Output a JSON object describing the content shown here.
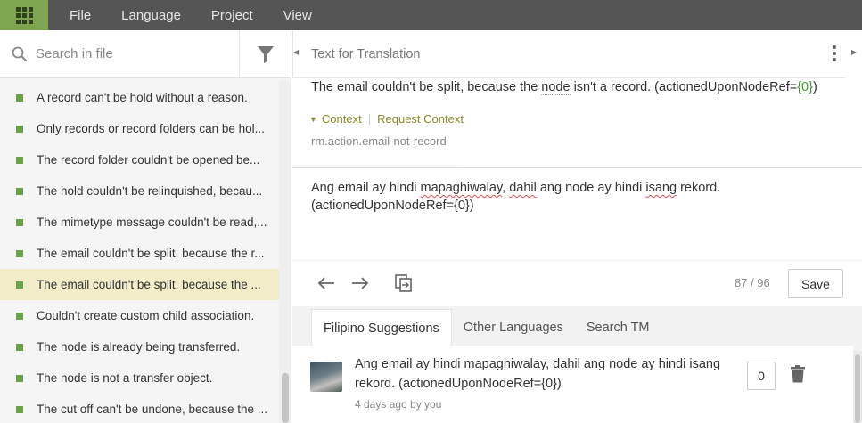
{
  "menu": {
    "items": [
      "File",
      "Language",
      "Project",
      "View"
    ]
  },
  "left": {
    "search_placeholder": "Search in file",
    "rows": [
      "A record can't be hold without a reason.",
      "Only records or record folders can be hol...",
      "The record folder couldn't be opened be...",
      "The hold couldn't be relinquished, becau...",
      "The mimetype message couldn't be read,...",
      "The email couldn't be split, because the r...",
      "The email couldn't be split, because the ...",
      "Couldn't create custom child association.",
      "The node is already being transferred.",
      "The node is not a transfer object.",
      "The cut off can't be undone, because the ..."
    ],
    "selected_index": 6
  },
  "editor": {
    "header_title": "Text for Translation",
    "source": {
      "before": "The email couldn't be split, because the ",
      "underlined": "node",
      "after": " isn't a record. (actionedUponNodeRef=",
      "placeholder": "{0}",
      "end": ")"
    },
    "context_label": "Context",
    "request_context_label": "Request Context",
    "context_key": "rm.action.email-not-record",
    "target": {
      "p1": "Ang email ay hindi ",
      "w1": "mapaghiwalay",
      "p2": ", ",
      "w2": "dahil",
      "p3": " ang node ay hindi ",
      "w3": "isang",
      "p4": " rekord.",
      "line2": "(actionedUponNodeRef={0})"
    },
    "counter": "87 / 96",
    "save_label": "Save"
  },
  "suggestions": {
    "tabs": [
      "Filipino Suggestions",
      "Other Languages",
      "Search TM"
    ],
    "active_tab": 0,
    "item": {
      "text": "Ang email ay hindi mapaghiwalay, dahil ang node ay hindi isang rekord. (actionedUponNodeRef={0})",
      "meta": "4 days ago by you",
      "count": "0"
    }
  },
  "colors": {
    "topbar": "#555555",
    "apps_button": "#7ea54f",
    "status_dot": "#6aa24a",
    "selected_row": "#f2ecc8",
    "link": "#8a8a2a"
  }
}
